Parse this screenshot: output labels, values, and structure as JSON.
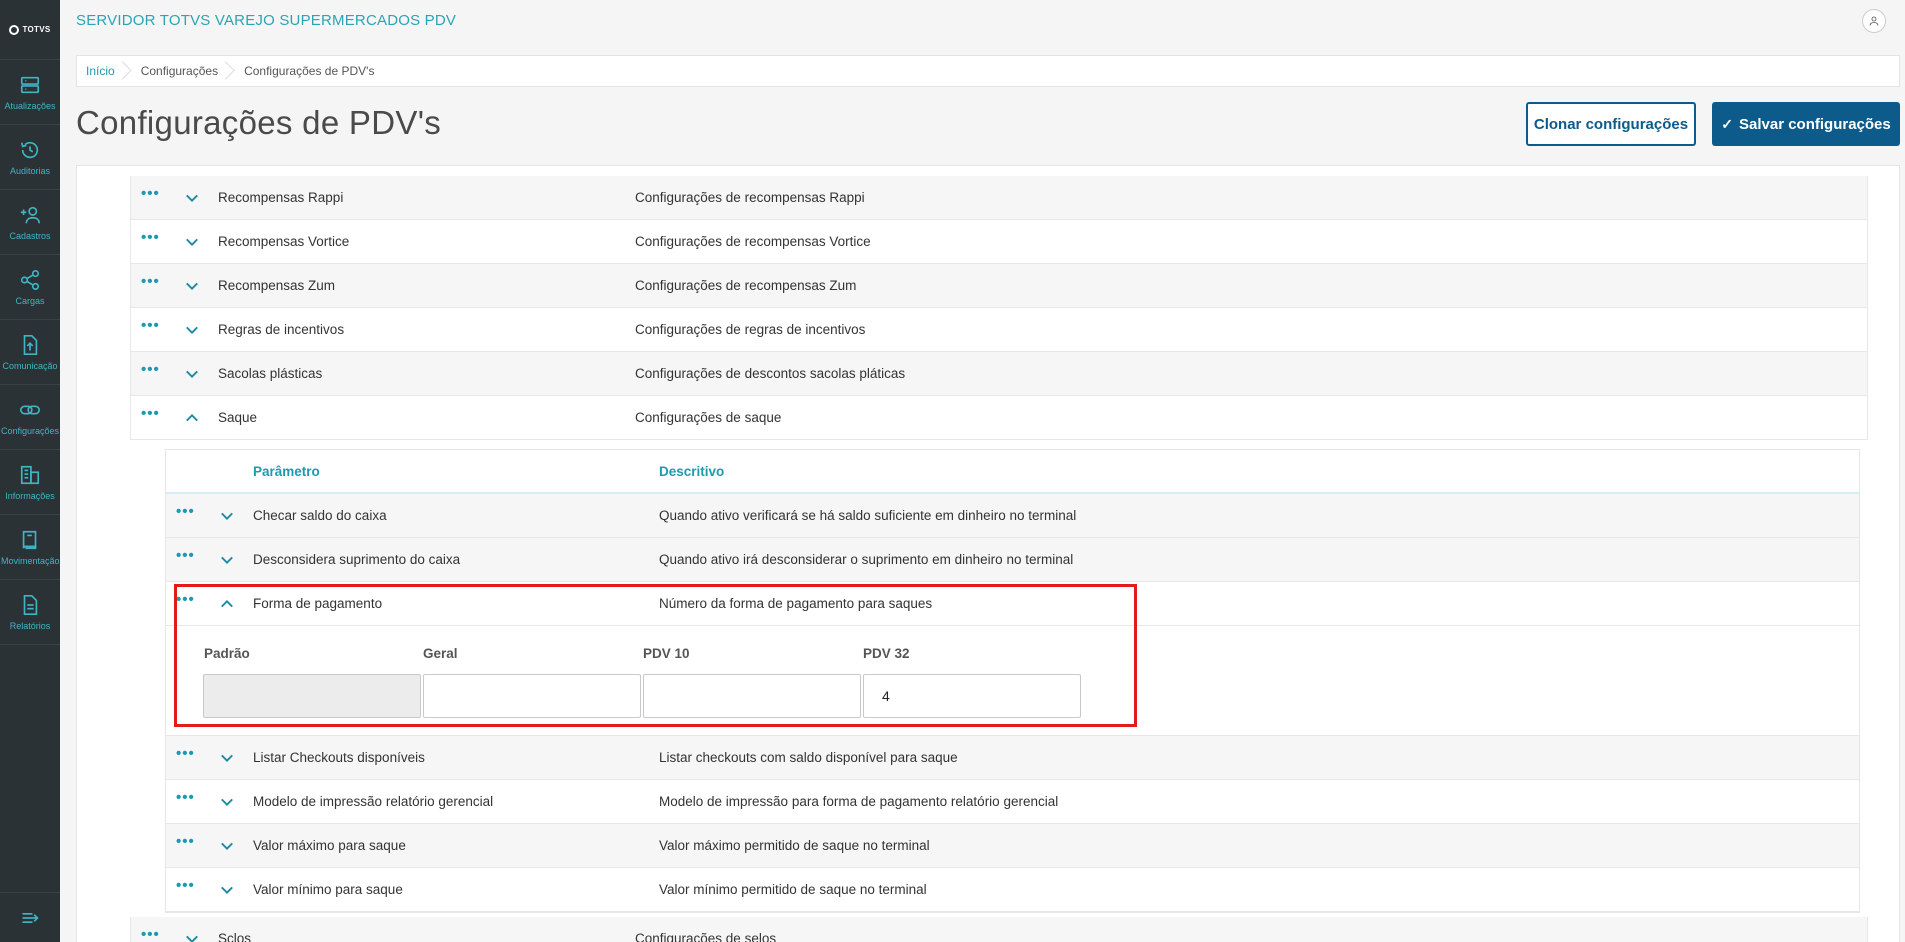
{
  "app": {
    "title": "SERVIDOR TOTVS VAREJO SUPERMERCADOS PDV",
    "logo_text": "TOTVS"
  },
  "sidebar": {
    "items": [
      {
        "label": "Atualizações",
        "icon": "server-icon"
      },
      {
        "label": "Auditorias",
        "icon": "history-icon"
      },
      {
        "label": "Cadastros",
        "icon": "add-user-icon"
      },
      {
        "label": "Cargas",
        "icon": "share-icon"
      },
      {
        "label": "Comunicação",
        "icon": "upload-file-icon"
      },
      {
        "label": "Configurações",
        "icon": "link-icon"
      },
      {
        "label": "Informações",
        "icon": "building-icon"
      },
      {
        "label": "Movimentação",
        "icon": "book-icon"
      },
      {
        "label": "Relatórios",
        "icon": "document-icon"
      }
    ]
  },
  "breadcrumb": [
    "Início",
    "Configurações",
    "Configurações de PDV's"
  ],
  "page": {
    "title": "Configurações de PDV's",
    "clone_button": "Clonar configurações",
    "save_button": "Salvar configurações"
  },
  "groups": [
    {
      "name": "Recompensas Rappi",
      "description": "Configurações de recompensas Rappi",
      "expanded": false
    },
    {
      "name": "Recompensas Vortice",
      "description": "Configurações de recompensas Vortice",
      "expanded": false
    },
    {
      "name": "Recompensas Zum",
      "description": "Configurações de recompensas Zum",
      "expanded": false
    },
    {
      "name": "Regras de incentivos",
      "description": "Configurações de regras de incentivos",
      "expanded": false
    },
    {
      "name": "Sacolas plásticas",
      "description": "Configurações de descontos sacolas pláticas",
      "expanded": false
    },
    {
      "name": "Saque",
      "description": "Configurações de saque",
      "expanded": true
    }
  ],
  "subtable": {
    "headers": {
      "param": "Parâmetro",
      "desc": "Descritivo"
    },
    "rows": [
      {
        "name": "Checar saldo do caixa",
        "description": "Quando ativo verificará se há saldo suficiente em dinheiro no terminal"
      },
      {
        "name": "Desconsidera suprimento do caixa",
        "description": "Quando ativo irá desconsiderar o suprimento em dinheiro no terminal"
      },
      {
        "name": "Forma de pagamento",
        "description": "Número da forma de pagamento para saques"
      },
      {
        "name": "Listar Checkouts disponíveis",
        "description": "Listar checkouts com saldo disponível para saque"
      },
      {
        "name": "Modelo de impressão relatório gerencial",
        "description": "Modelo de impressão para forma de pagamento relatório gerencial"
      },
      {
        "name": "Valor máximo para saque",
        "description": "Valor máximo permitido de saque no terminal"
      },
      {
        "name": "Valor mínimo para saque",
        "description": "Valor mínimo permitido de saque no terminal"
      }
    ],
    "fields": [
      {
        "label": "Padrão",
        "value": ""
      },
      {
        "label": "Geral",
        "value": ""
      },
      {
        "label": "PDV 10",
        "value": ""
      },
      {
        "label": "PDV 32",
        "value": "4"
      }
    ]
  },
  "next_group": {
    "name": "Sclos",
    "description": "Configurações de selos"
  },
  "colors": {
    "accent": "#1c9ab0",
    "primary": "#0c5b8a",
    "sidebar": "#2b3236",
    "highlight": "#e41b1b"
  }
}
